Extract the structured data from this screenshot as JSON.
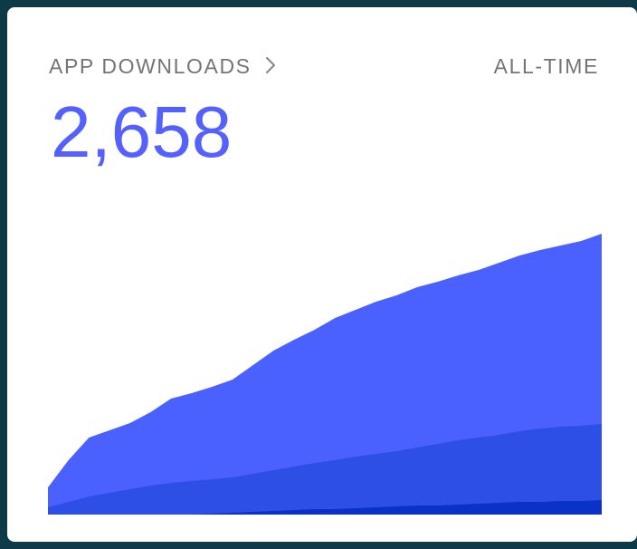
{
  "card": {
    "title": "APP DOWNLOADS",
    "title_icon": "chevron-right-icon",
    "range_label": "ALL-TIME",
    "total": "2,658"
  },
  "colors": {
    "background": "#0e3a48",
    "card": "#ffffff",
    "text": "#747474",
    "accent": "#5561ff",
    "series_1": "#4a60ff",
    "series_2": "#2d4fe6",
    "series_3": "#0a32c8"
  },
  "chart_data": {
    "type": "area",
    "stacked": true,
    "series": [
      {
        "values": [
          30,
          60,
          85,
          93,
          101,
          113,
          128,
          134,
          141,
          149,
          165,
          181,
          193,
          204,
          217,
          226,
          235,
          242,
          251,
          257,
          264,
          270,
          278,
          286,
          292,
          297,
          302,
          310
        ]
      },
      {
        "values": [
          8,
          14,
          20,
          24,
          28,
          32,
          35,
          37,
          39,
          41,
          45,
          49,
          53,
          57,
          60,
          64,
          67,
          70,
          74,
          78,
          82,
          85,
          88,
          92,
          95,
          97,
          98,
          100
        ]
      },
      {
        "values": [
          0,
          0,
          0,
          0,
          0,
          0,
          0,
          0,
          1,
          2,
          3,
          4,
          5,
          6,
          6,
          7,
          8,
          9,
          10,
          10,
          11,
          12,
          13,
          14,
          14,
          15,
          15,
          16
        ]
      }
    ],
    "ylim": [
      0,
      350
    ]
  }
}
